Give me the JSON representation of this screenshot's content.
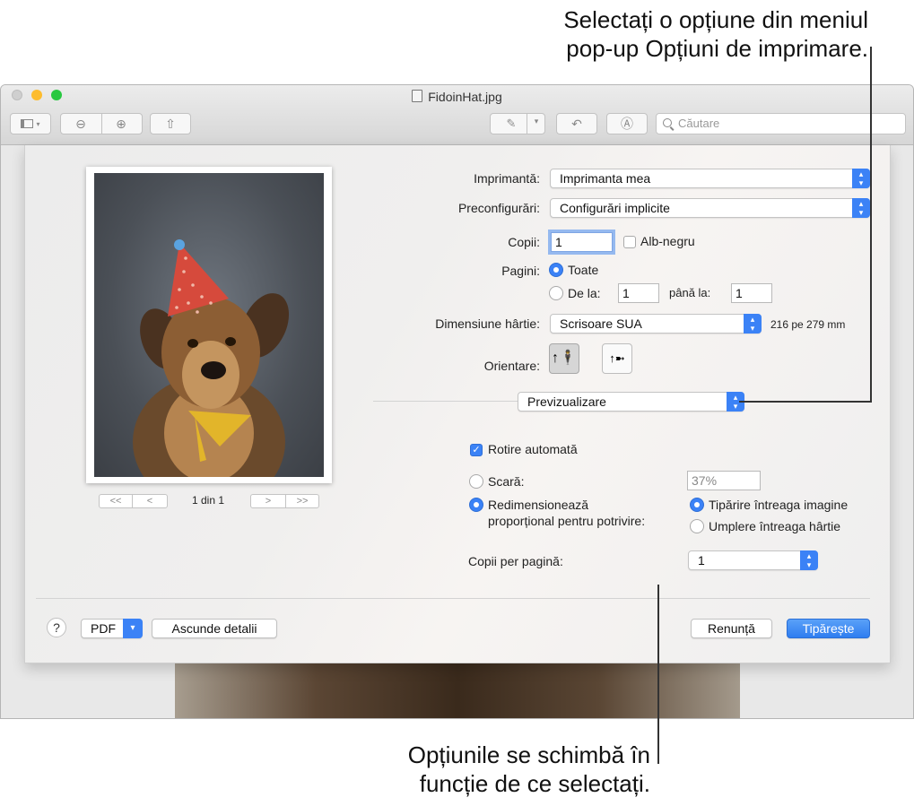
{
  "callouts": {
    "top_line1": "Selectați o opțiune din meniul",
    "top_line2": "pop-up Opțiuni de imprimare.",
    "bottom_line1": "Opțiunile se schimbă în",
    "bottom_line2": "funcție de ce selectați."
  },
  "window": {
    "title": "FidoinHat.jpg",
    "search_placeholder": "Căutare"
  },
  "print": {
    "printer_label": "Imprimantă:",
    "printer_value": "Imprimanta mea",
    "presets_label": "Preconfigurări:",
    "presets_value": "Configurări implicite",
    "copies_label": "Copii:",
    "copies_value": "1",
    "bw_label": "Alb-negru",
    "pages_label": "Pagini:",
    "pages_all": "Toate",
    "pages_from": "De la:",
    "from_value": "1",
    "pages_to": "până la:",
    "to_value": "1",
    "paper_label": "Dimensiune hârtie:",
    "paper_value": "Scrisoare SUA",
    "paper_dims": "216 pe 279 mm",
    "orientation_label": "Orientare:",
    "section_popup": "Previzualizare",
    "auto_rotate": "Rotire automată",
    "scale_label": "Scară:",
    "scale_value": "37%",
    "scale_to_fit_line1": "Redimensionează",
    "scale_to_fit_line2": "proporțional pentru potrivire:",
    "print_entire": "Tipărire întreaga imagine",
    "fill_paper": "Umplere întreaga hârtie",
    "copies_per_page_label": "Copii per pagină:",
    "copies_per_page_value": "1",
    "page_indicator": "1 din 1",
    "pdf_button": "PDF",
    "hide_details": "Ascunde detalii",
    "cancel": "Renunță",
    "print_button": "Tipărește"
  },
  "colors": {
    "accent": "#3b82f6",
    "close": "#fc5f57",
    "minimize": "#fdbc2e",
    "zoom": "#28c840"
  }
}
